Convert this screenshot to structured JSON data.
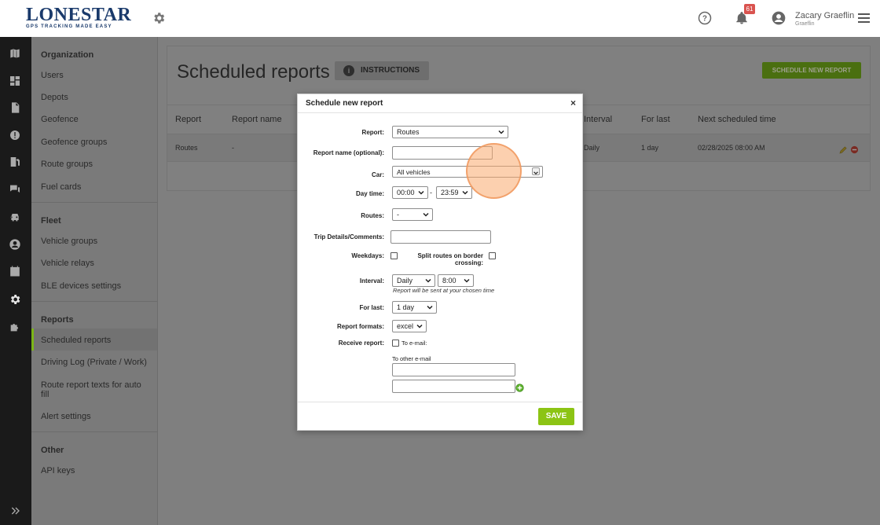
{
  "topbar": {
    "logo_main": "LONESTAR",
    "logo_sub": "GPS TRACKING MADE EASY",
    "notification_count": "61",
    "user_name": "Zacary Graeflin",
    "user_sub": "Graeflin"
  },
  "sidebar": {
    "sections": [
      {
        "title": "Organization",
        "items": [
          "Users",
          "Depots",
          "Geofence",
          "Geofence groups",
          "Route groups",
          "Fuel cards"
        ]
      },
      {
        "title": "Fleet",
        "items": [
          "Vehicle groups",
          "Vehicle relays",
          "BLE devices settings"
        ]
      },
      {
        "title": "Reports",
        "items": [
          "Scheduled reports",
          "Driving Log (Private / Work)",
          "Route report texts for auto fill",
          "Alert settings"
        ]
      },
      {
        "title": "Other",
        "items": [
          "API keys"
        ]
      }
    ],
    "active_item": "Scheduled reports"
  },
  "main": {
    "title": "Scheduled reports",
    "instructions_label": "INSTRUCTIONS",
    "schedule_button": "SCHEDULE NEW REPORT",
    "columns": [
      "Report",
      "Report name",
      "Interval",
      "For last",
      "Next scheduled time"
    ],
    "rows": [
      {
        "report": "Routes",
        "report_name": "-",
        "interval": "Daily",
        "for_last": "1 day",
        "next_time": "02/28/2025 08:00 AM"
      }
    ]
  },
  "modal": {
    "title": "Schedule new report",
    "close": "×",
    "fields": {
      "report_label": "Report:",
      "report_value": "Routes",
      "report_name_label": "Report name (optional):",
      "car_label": "Car:",
      "car_value": "All vehicles",
      "day_time_label": "Day time:",
      "time_from": "00:00",
      "time_to": "23:59",
      "time_sep": "-",
      "routes_label": "Routes:",
      "routes_value": "-",
      "trip_details_label": "Trip Details/Comments:",
      "weekdays_label": "Weekdays:",
      "split_routes_label_1": "Split routes on border",
      "split_routes_label_2": "crossing:",
      "interval_label": "Interval:",
      "interval_value": "Daily",
      "interval_time": "8:00",
      "interval_hint": "Report will be sent at your chosen time",
      "for_last_label": "For last:",
      "for_last_value": "1 day",
      "formats_label": "Report formats:",
      "formats_value": "excel",
      "receive_label": "Receive report:",
      "to_email_label": "To e-mail:",
      "other_email_label": "To other e-mail"
    },
    "save_label": "SAVE"
  },
  "colors": {
    "accent_green": "#8cc414",
    "badge_red": "#d9534f",
    "brand_blue": "#1a3a6b"
  }
}
